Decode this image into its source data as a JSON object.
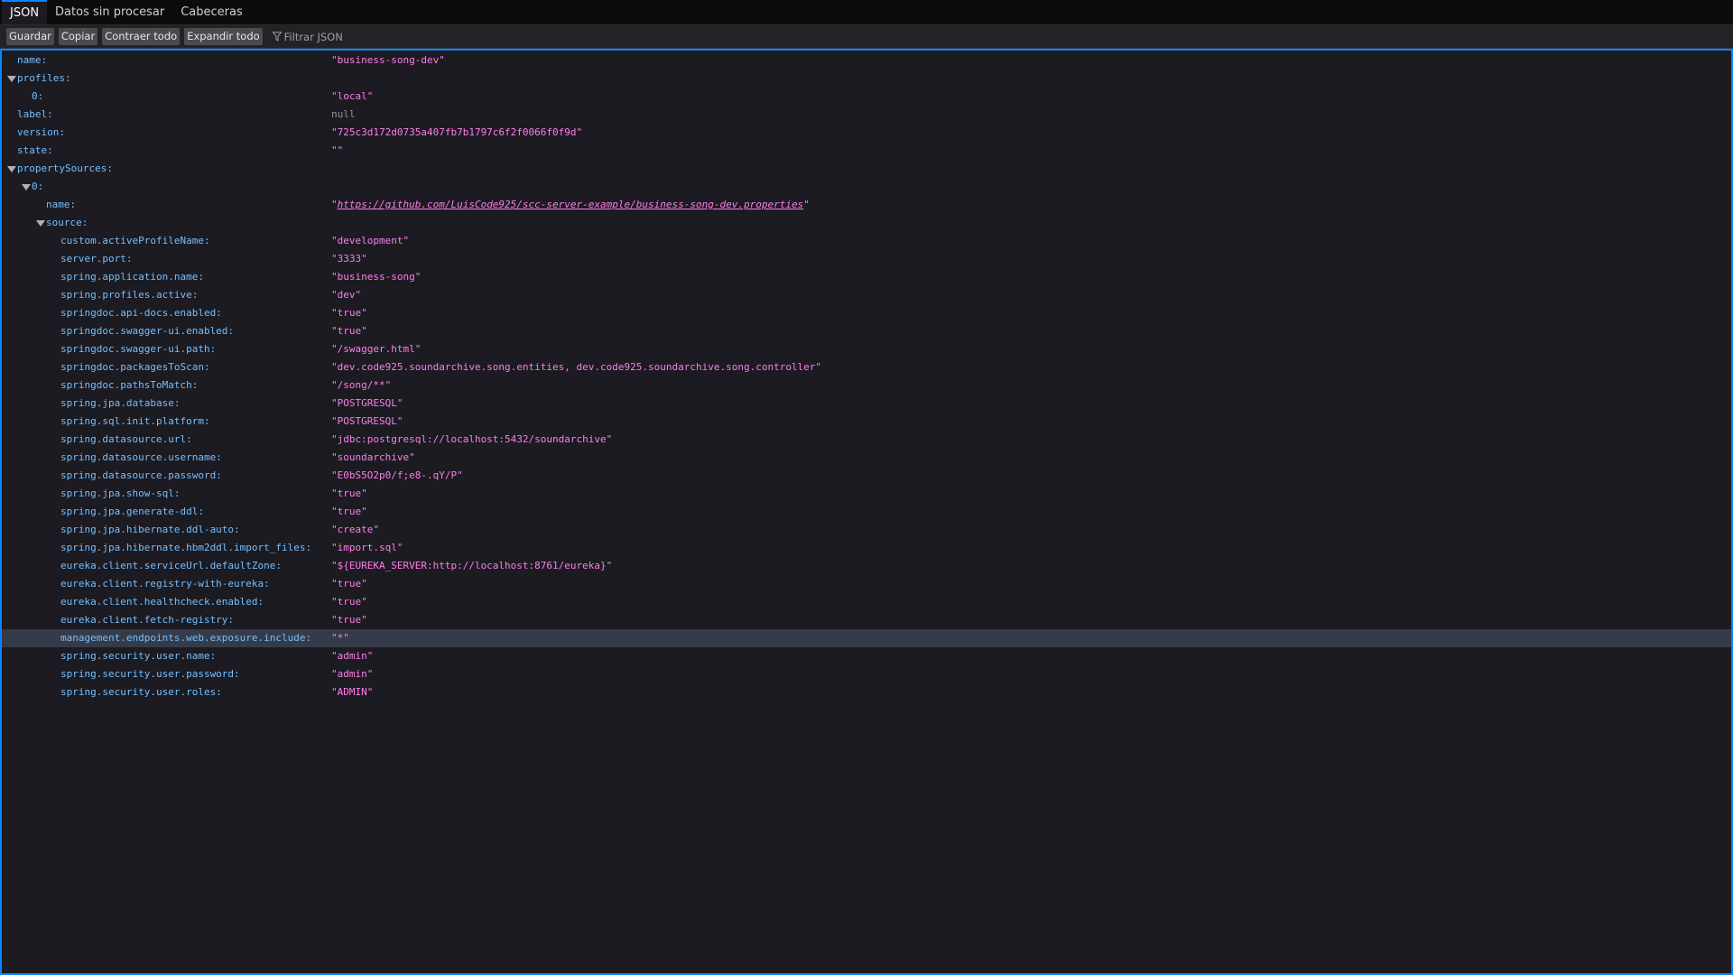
{
  "tabs": [
    {
      "label": "JSON",
      "selected": true
    },
    {
      "label": "Datos sin procesar",
      "selected": false
    },
    {
      "label": "Cabeceras",
      "selected": false
    }
  ],
  "toolbar": {
    "save": "Guardar",
    "copy": "Copiar",
    "collapse_all": "Contraer todo",
    "expand_all": "Expandir todo",
    "filter_placeholder": "Filtrar JSON"
  },
  "colors": {
    "accent": "#0a84ff",
    "key": "#75bfff",
    "string": "#ff7de9",
    "null": "#939395",
    "highlight_row": "#353b48"
  },
  "rows": [
    {
      "key": "name:",
      "value": "\"business-song-dev\"",
      "type": "string"
    },
    {
      "key": "profiles:",
      "expanded": true
    },
    {
      "key": "0:",
      "value": "\"local\"",
      "type": "string"
    },
    {
      "key": "label:",
      "value": "null",
      "type": "null"
    },
    {
      "key": "version:",
      "value": "\"725c3d172d0735a407fb7b1797c6f2f0066f0f9d\"",
      "type": "string"
    },
    {
      "key": "state:",
      "value": "\"\"",
      "type": "string"
    },
    {
      "key": "propertySources:",
      "expanded": true
    },
    {
      "key": "0:",
      "expanded": true
    },
    {
      "key": "name:",
      "value": "https://github.com/LuisCode925/scc-server-example/business-song-dev.properties",
      "type": "link"
    },
    {
      "key": "source:",
      "expanded": true
    },
    {
      "key": "custom.activeProfileName:",
      "value": "\"development\"",
      "type": "string"
    },
    {
      "key": "server.port:",
      "value": "\"3333\"",
      "type": "string"
    },
    {
      "key": "spring.application.name:",
      "value": "\"business-song\"",
      "type": "string"
    },
    {
      "key": "spring.profiles.active:",
      "value": "\"dev\"",
      "type": "string"
    },
    {
      "key": "springdoc.api-docs.enabled:",
      "value": "\"true\"",
      "type": "string"
    },
    {
      "key": "springdoc.swagger-ui.enabled:",
      "value": "\"true\"",
      "type": "string"
    },
    {
      "key": "springdoc.swagger-ui.path:",
      "value": "\"/swagger.html\"",
      "type": "string"
    },
    {
      "key": "springdoc.packagesToScan:",
      "value": "\"dev.code925.soundarchive.song.entities, dev.code925.soundarchive.song.controller\"",
      "type": "string"
    },
    {
      "key": "springdoc.pathsToMatch:",
      "value": "\"/song/**\"",
      "type": "string"
    },
    {
      "key": "spring.jpa.database:",
      "value": "\"POSTGRESQL\"",
      "type": "string"
    },
    {
      "key": "spring.sql.init.platform:",
      "value": "\"POSTGRESQL\"",
      "type": "string"
    },
    {
      "key": "spring.datasource.url:",
      "value": "\"jdbc:postgresql://localhost:5432/soundarchive\"",
      "type": "string"
    },
    {
      "key": "spring.datasource.username:",
      "value": "\"soundarchive\"",
      "type": "string"
    },
    {
      "key": "spring.datasource.password:",
      "value": "\"E0bS5O2p0/f;e8-.qY/P\"",
      "type": "string"
    },
    {
      "key": "spring.jpa.show-sql:",
      "value": "\"true\"",
      "type": "string"
    },
    {
      "key": "spring.jpa.generate-ddl:",
      "value": "\"true\"",
      "type": "string"
    },
    {
      "key": "spring.jpa.hibernate.ddl-auto:",
      "value": "\"create\"",
      "type": "string"
    },
    {
      "key": "spring.jpa.hibernate.hbm2ddl.import_files:",
      "value": "\"import.sql\"",
      "type": "string"
    },
    {
      "key": "eureka.client.serviceUrl.defaultZone:",
      "value": "\"${EUREKA_SERVER:http://localhost:8761/eureka}\"",
      "type": "string"
    },
    {
      "key": "eureka.client.registry-with-eureka:",
      "value": "\"true\"",
      "type": "string"
    },
    {
      "key": "eureka.client.healthcheck.enabled:",
      "value": "\"true\"",
      "type": "string"
    },
    {
      "key": "eureka.client.fetch-registry:",
      "value": "\"true\"",
      "type": "string"
    },
    {
      "key": "management.endpoints.web.exposure.include:",
      "value": "\"*\"",
      "type": "string",
      "highlighted": true
    },
    {
      "key": "spring.security.user.name:",
      "value": "\"admin\"",
      "type": "string"
    },
    {
      "key": "spring.security.user.password:",
      "value": "\"admin\"",
      "type": "string"
    },
    {
      "key": "spring.security.user.roles:",
      "value": "\"ADMIN\"",
      "type": "string"
    }
  ]
}
